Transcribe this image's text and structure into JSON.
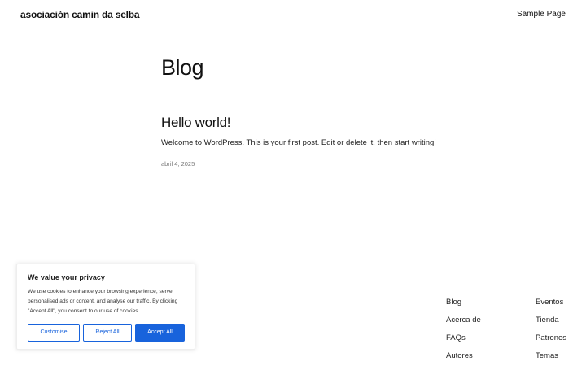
{
  "header": {
    "site_title": "asociación camin da selba",
    "nav": {
      "sample_page": "Sample Page"
    }
  },
  "main": {
    "page_title": "Blog",
    "post": {
      "title": "Hello world!",
      "excerpt": "Welcome to WordPress. This is your first post. Edit or delete it, then start writing!",
      "date": "abril 4, 2025"
    }
  },
  "footer": {
    "col1": [
      "Blog",
      "Acerca de",
      "FAQs",
      "Autores"
    ],
    "col2": [
      "Eventos",
      "Tienda",
      "Patrones",
      "Temas"
    ]
  },
  "cookie": {
    "title": "We value your privacy",
    "text": "We use cookies to enhance your browsing experience, serve personalised ads or content, and analyse our traffic. By clicking \"Accept All\", you consent to our use of cookies.",
    "customise": "Customise",
    "reject": "Reject All",
    "accept": "Accept All",
    "accent_color": "#1863dc"
  }
}
